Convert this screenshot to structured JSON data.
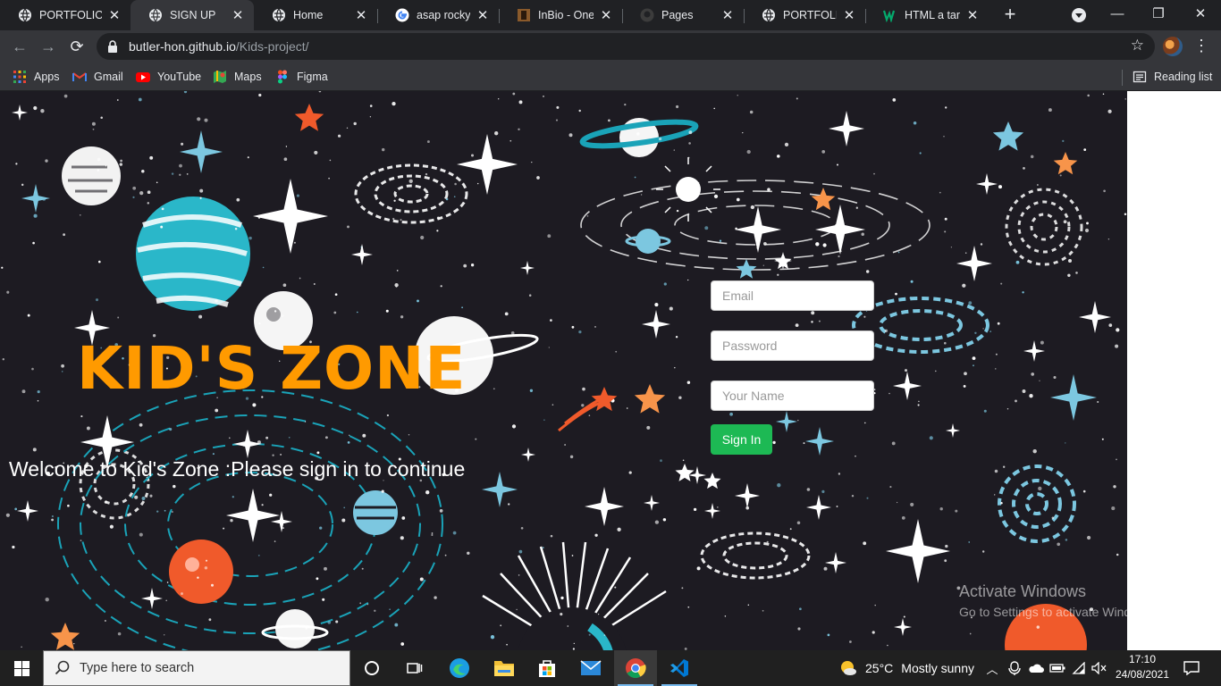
{
  "browser": {
    "tabs": [
      {
        "title": "PORTFOLIO",
        "icon": "globe-icon",
        "active": false
      },
      {
        "title": "SIGN UP",
        "icon": "globe-icon",
        "active": true
      },
      {
        "title": "Home",
        "icon": "globe-icon",
        "active": false
      },
      {
        "title": "asap rocky tu",
        "icon": "google-icon",
        "active": false
      },
      {
        "title": "InBio - One Pa",
        "icon": "inbio-icon",
        "active": false
      },
      {
        "title": "Pages",
        "icon": "github-icon",
        "active": false
      },
      {
        "title": "PORTFOLIO",
        "icon": "globe-icon",
        "active": false
      },
      {
        "title": "HTML a targe",
        "icon": "w3-icon",
        "active": false
      }
    ],
    "new_tab_label": "+",
    "url_host": "butler-hon.github.io",
    "url_path": "/Kids-project/",
    "bookmarks": [
      {
        "label": "Apps",
        "icon": "apps-grid-icon"
      },
      {
        "label": "Gmail",
        "icon": "gmail-icon"
      },
      {
        "label": "YouTube",
        "icon": "youtube-icon"
      },
      {
        "label": "Maps",
        "icon": "maps-icon"
      },
      {
        "label": "Figma",
        "icon": "figma-icon"
      }
    ],
    "reading_list_label": "Reading list"
  },
  "page": {
    "title": "KID'S ZONE",
    "welcome": "Welcome to Kid's Zone :Please sign in to continue",
    "form": {
      "email_placeholder": "Email",
      "password_placeholder": "Password",
      "name_placeholder": "Your Name",
      "submit_label": "Sign In"
    },
    "colors": {
      "title": "#ff9a00",
      "background": "#1d1b22",
      "button": "#1db954"
    }
  },
  "watermark": {
    "line1": "Activate Windows",
    "line2": "Go to Settings to activate Windows."
  },
  "taskbar": {
    "search_placeholder": "Type here to search",
    "weather_temp": "25°C",
    "weather_desc": "Mostly sunny",
    "time": "17:10",
    "date": "24/08/2021"
  }
}
